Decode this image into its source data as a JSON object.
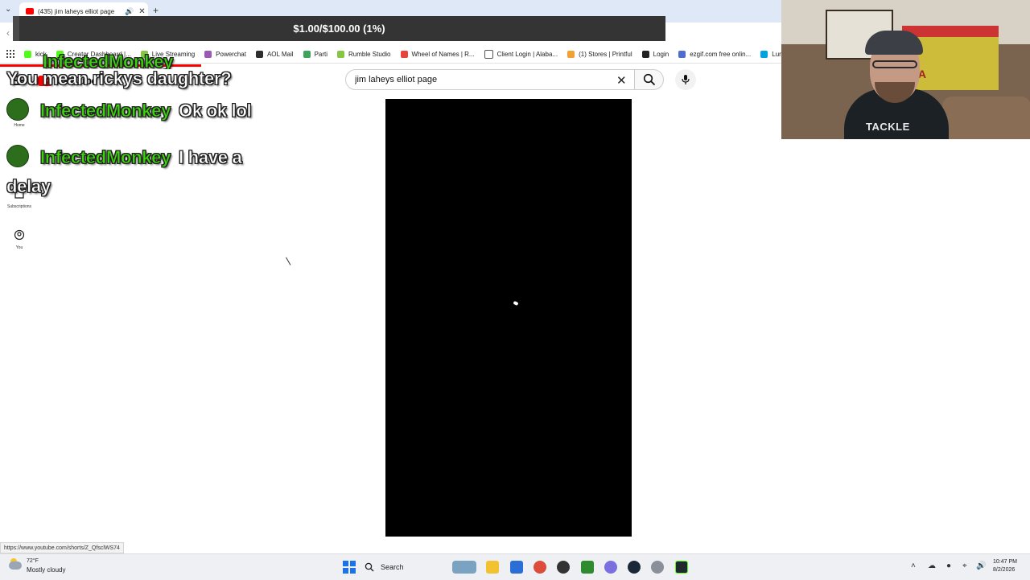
{
  "browser": {
    "tab": {
      "title": "(435) jim laheys elliot page"
    },
    "bookmarks": [
      {
        "label": "kick",
        "color": "#53fc18"
      },
      {
        "label": "Creator Dashboard |...",
        "color": "#53fc18"
      },
      {
        "label": "Live Streaming",
        "color": "#85c742"
      },
      {
        "label": "Powerchat",
        "color": "#9b59b6"
      },
      {
        "label": "AOL Mail",
        "color": "#2e2e2e"
      },
      {
        "label": "Parti",
        "color": "#3ba55c"
      },
      {
        "label": "Rumble Studio",
        "color": "#85c742"
      },
      {
        "label": "Wheel of Names | R...",
        "color": "#e8423b"
      },
      {
        "label": "Client Login | Alaba...",
        "color": "#ffffff"
      },
      {
        "label": "(1) Stores | Printful",
        "color": "#f2a233"
      },
      {
        "label": "Login",
        "color": "#222222"
      },
      {
        "label": "ezgif.com free onlin...",
        "color": "#4f6dd1"
      },
      {
        "label": "Luna",
        "color": "#00a3e0"
      }
    ],
    "status_url": "https://www.youtube.com/shorts/Z_QfsclWS74"
  },
  "overlay": {
    "donation": {
      "text": "$1.00/$100.00 (1%)",
      "progress_percent": 1
    },
    "chat": [
      {
        "user": "InfectedMonkey",
        "message": "You mean rickys daughter?"
      },
      {
        "user": "InfectedMonkey",
        "message": "Ok ok lol"
      },
      {
        "user": "InfectedMonkey",
        "message": "I have a delay"
      }
    ],
    "webcam": {
      "flag_text": "TEA",
      "shirt_text": "TACKLE"
    }
  },
  "youtube": {
    "logo_text": "YouTube",
    "search": {
      "query": "jim laheys elliot page"
    },
    "sidebar": {
      "home_label": "Home",
      "subscriptions_label": "Subscriptions",
      "you_label": "You"
    }
  },
  "taskbar": {
    "weather": {
      "temp": "72°F",
      "desc": "Mostly cloudy"
    },
    "search_label": "Search",
    "time": "10:47 PM",
    "date": "8/2/2026"
  },
  "colors": {
    "accent_green": "#3bd40c",
    "youtube_red": "#ff0000",
    "windows_blue": "#1a73e8"
  }
}
